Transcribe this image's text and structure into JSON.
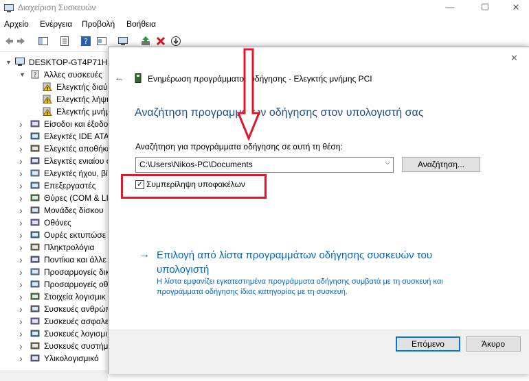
{
  "window": {
    "title": "Διαχείριση Συσκευών",
    "controls": {
      "minimize": "—",
      "maximize": "☐",
      "close": "✕"
    }
  },
  "menu": [
    "Αρχείο",
    "Ενέργεια",
    "Προβολή",
    "Βοήθεια"
  ],
  "toolbar_icons": [
    "back-icon",
    "forward-icon",
    "show-hide-tree-icon",
    "properties-icon",
    "help-icon",
    "view-icon",
    "scan-hardware-icon",
    "update-driver-icon",
    "uninstall-icon",
    "disable-icon"
  ],
  "tree": {
    "root": "DESKTOP-GT4P71H",
    "items": [
      {
        "label": "Άλλες συσκευές",
        "expanded": true,
        "icon": "unknown-device-icon"
      },
      {
        "label": "Ελεγκτής διαύ",
        "child": true,
        "icon": "warning-device-icon"
      },
      {
        "label": "Ελεγκτής λήψη",
        "child": true,
        "icon": "warning-device-icon"
      },
      {
        "label": "Ελεγκτής μνήμ",
        "child": true,
        "icon": "warning-device-icon"
      },
      {
        "label": "Είσοδοι και έξοδο",
        "icon": "audio-io-icon"
      },
      {
        "label": "Ελεγκτές IDE ATA/",
        "icon": "ide-controller-icon"
      },
      {
        "label": "Ελεγκτές αποθήκε",
        "icon": "storage-controller-icon"
      },
      {
        "label": "Ελεγκτές ενιαίου ο",
        "icon": "usb-controller-icon"
      },
      {
        "label": "Ελεγκτές ήχου, βί",
        "icon": "sound-controller-icon"
      },
      {
        "label": "Επεξεργαστές",
        "icon": "processor-icon"
      },
      {
        "label": "Θύρες (COM & LI",
        "icon": "port-icon"
      },
      {
        "label": "Μονάδες δίσκου",
        "icon": "disk-drive-icon"
      },
      {
        "label": "Οθόνες",
        "icon": "monitor-icon"
      },
      {
        "label": "Ουρές εκτυπώσε",
        "icon": "print-queue-icon"
      },
      {
        "label": "Πληκτρολόγια",
        "icon": "keyboard-icon"
      },
      {
        "label": "Ποντίκια και άλλε",
        "icon": "mouse-icon"
      },
      {
        "label": "Προσαρμογείς δικ",
        "icon": "network-adapter-icon"
      },
      {
        "label": "Προσαρμογείς οθ",
        "icon": "display-adapter-icon"
      },
      {
        "label": "Στοιχεία λογισμικ",
        "icon": "software-component-icon"
      },
      {
        "label": "Συσκευές ανθρώπ",
        "icon": "hid-icon"
      },
      {
        "label": "Συσκευές ασφαλε",
        "icon": "security-device-icon"
      },
      {
        "label": "Συσκευές λογισμι",
        "icon": "software-device-icon"
      },
      {
        "label": "Συσκευές συστήμ",
        "icon": "system-device-icon"
      },
      {
        "label": "Υλικολογισμικό",
        "icon": "firmware-icon"
      }
    ]
  },
  "dialog": {
    "header": "Ενημέρωση προγράμματος οδήγησης - Ελεγκτής μνήμης PCI",
    "heading": "Αναζήτηση προγραμμάτων οδήγησης στον υπολογιστή σας",
    "search_label": "Αναζήτηση για προγράμματα οδήγησης σε αυτή τη θέση:",
    "path_value": "C:\\Users\\Nikos-PC\\Documents",
    "browse_button": "Αναζήτηση...",
    "include_subfolders": "Συμπερίληψη υποφακέλων",
    "include_subfolders_checked": true,
    "pick_link_line1": "Επιλογή από λίστα προγραμμάτων οδήγησης συσκευών του",
    "pick_link_line2": "υπολογιστή",
    "pick_desc_line1": "Η λίστα εμφανίζει εγκατεστημένα προγράμματα οδήγησης συμβατά με τη συσκευή και",
    "pick_desc_line2": "προγράμματα οδήγησης ίδιας κατηγορίας με τη συσκευή.",
    "next_button": "Επόμενο",
    "cancel_button": "Άκυρο",
    "close_glyph": "✕",
    "back_glyph": "←",
    "link_arrow": "→"
  },
  "colors": {
    "heading": "#1e4e8c",
    "link": "#0066cc",
    "annotation": "#e0162b"
  }
}
